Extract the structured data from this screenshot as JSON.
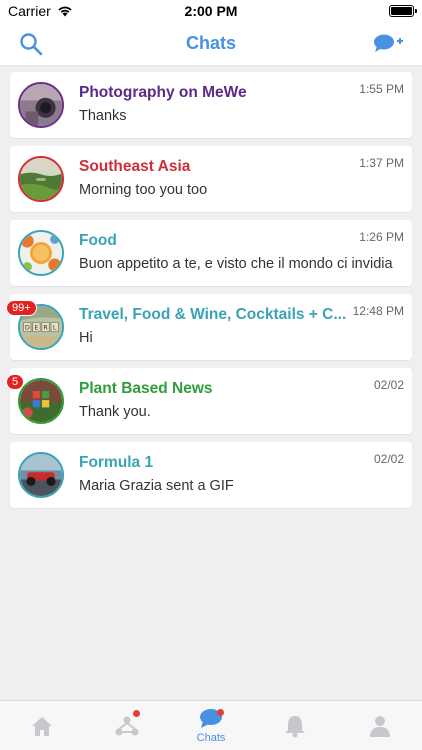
{
  "status_bar": {
    "carrier": "Carrier",
    "time": "2:00 PM"
  },
  "header": {
    "title": "Chats"
  },
  "colors": {
    "accent": "#4a90e2",
    "badge": "#e02424"
  },
  "chats": [
    {
      "name": "Photography on MeWe",
      "time": "1:55 PM",
      "preview": "Thanks",
      "name_color": "#5b2a86",
      "ring_color": "#6b2f8a",
      "badge": ""
    },
    {
      "name": "Southeast Asia",
      "time": "1:37 PM",
      "preview": "Morning too you too",
      "name_color": "#cf2e3a",
      "ring_color": "#cf2e3a",
      "badge": ""
    },
    {
      "name": "Food",
      "time": "1:26 PM",
      "preview": "Buon appetito a te, e visto che il mondo ci invidia",
      "name_color": "#3aa3b5",
      "ring_color": "#3aa3b5",
      "badge": ""
    },
    {
      "name": "Travel, Food & Wine, Cocktails + C...",
      "time": "12:48 PM",
      "preview": "Hi",
      "name_color": "#3aa3b5",
      "ring_color": "#3aa3b5",
      "badge": "99+"
    },
    {
      "name": "Plant Based News",
      "time": "02/02",
      "preview": "Thank you.",
      "name_color": "#2e9e3a",
      "ring_color": "#2e9e3a",
      "badge": "5"
    },
    {
      "name": "Formula 1",
      "time": "02/02",
      "preview": "Maria Grazia sent a GIF",
      "name_color": "#3aa3b5",
      "ring_color": "#3aa3b5",
      "badge": ""
    }
  ],
  "tabs": [
    {
      "icon": "home-icon",
      "label": "",
      "dot": false
    },
    {
      "icon": "groups-icon",
      "label": "",
      "dot": true
    },
    {
      "icon": "chat-bubble-icon",
      "label": "Chats",
      "dot": true
    },
    {
      "icon": "bell-icon",
      "label": "",
      "dot": false
    },
    {
      "icon": "profile-icon",
      "label": "",
      "dot": false
    }
  ]
}
